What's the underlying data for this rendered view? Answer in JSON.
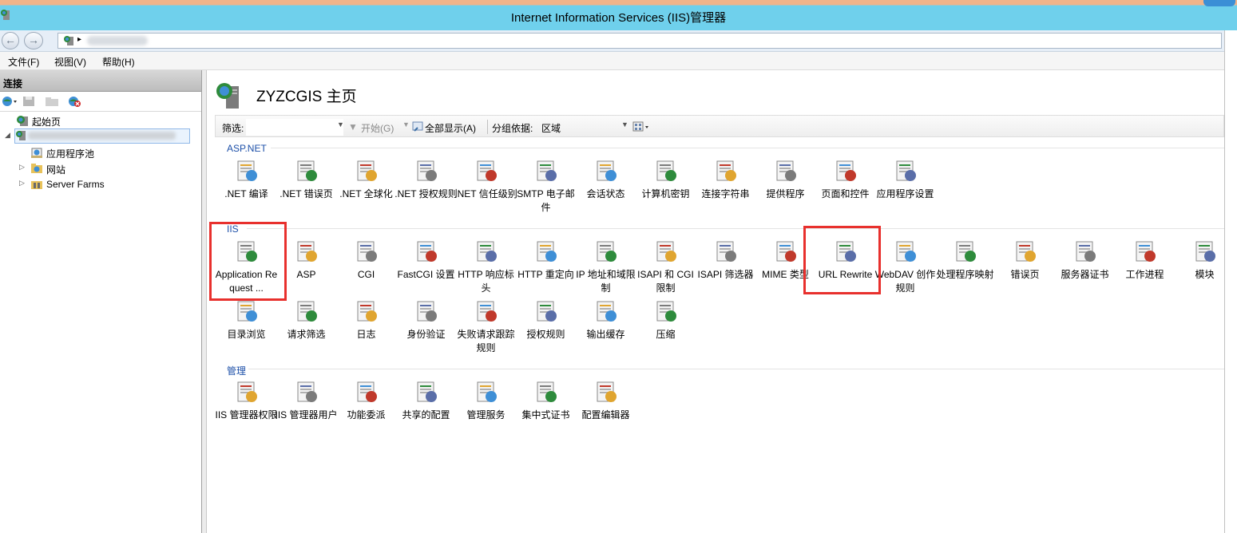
{
  "window": {
    "title": "Internet Information Services (IIS)管理器"
  },
  "menu": [
    "文件(F)",
    "视图(V)",
    "帮助(H)"
  ],
  "connections": {
    "header": "连接",
    "tree": {
      "start_page": "起始页",
      "app_pools": "应用程序池",
      "sites": "网站",
      "server_farms": "Server Farms"
    }
  },
  "main": {
    "title": "ZYZCGIS 主页",
    "filter": {
      "label": "筛选:",
      "start": "开始(G)",
      "show_all": "全部显示(A)",
      "group_by": "分组依据:",
      "group_value": "区域"
    },
    "sections": [
      {
        "name": "ASP.NET",
        "items": [
          ".NET 编译",
          ".NET 错误页",
          ".NET 全球化",
          ".NET 授权规则",
          ".NET 信任级别",
          "SMTP 电子邮件",
          "会话状态",
          "计算机密钥",
          "连接字符串",
          "提供程序",
          "页面和控件",
          "应用程序设置"
        ]
      },
      {
        "name": "IIS",
        "items": [
          "Application Request ...",
          "ASP",
          "CGI",
          "FastCGI 设置",
          "HTTP 响应标头",
          "HTTP 重定向",
          "IP 地址和域限制",
          "ISAPI 和 CGI 限制",
          "ISAPI 筛选器",
          "MIME 类型",
          "URL Rewrite",
          "WebDAV 创作规则",
          "处理程序映射",
          "错误页",
          "服务器证书",
          "工作进程",
          "模块",
          "目录浏览",
          "请求筛选",
          "日志",
          "身份验证",
          "失败请求跟踪规则",
          "授权规则",
          "输出缓存",
          "压缩"
        ]
      },
      {
        "name": "管理",
        "items": [
          "IIS 管理器权限",
          "IIS 管理器用户",
          "功能委派",
          "共享的配置",
          "管理服务",
          "集中式证书",
          "配置编辑器"
        ]
      }
    ]
  },
  "colors": {
    "titlebar": "#6fd0ec",
    "highlight": "#e8302d",
    "section_header": "#1c4fa8"
  }
}
